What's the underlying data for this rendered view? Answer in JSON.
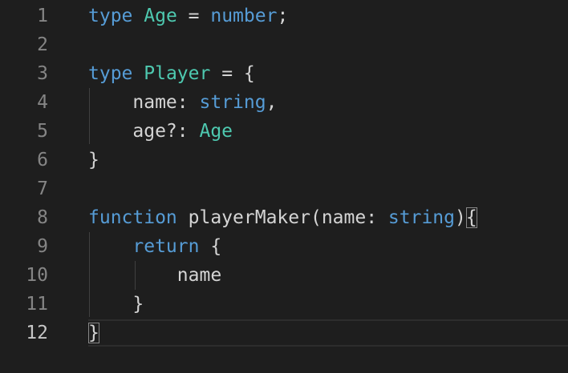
{
  "editor": {
    "current_line": 12,
    "lines": [
      {
        "number": "1",
        "tokens": [
          {
            "t": "type",
            "c": "kw"
          },
          {
            "t": " ",
            "c": "pn"
          },
          {
            "t": "Age",
            "c": "ty"
          },
          {
            "t": " = ",
            "c": "pn"
          },
          {
            "t": "number",
            "c": "kw"
          },
          {
            "t": ";",
            "c": "pn"
          }
        ]
      },
      {
        "number": "2",
        "tokens": []
      },
      {
        "number": "3",
        "tokens": [
          {
            "t": "type",
            "c": "kw"
          },
          {
            "t": " ",
            "c": "pn"
          },
          {
            "t": "Player",
            "c": "ty"
          },
          {
            "t": " = {",
            "c": "pn"
          }
        ]
      },
      {
        "number": "4",
        "tokens": [
          {
            "t": "    name",
            "c": "id"
          },
          {
            "t": ": ",
            "c": "pn"
          },
          {
            "t": "string",
            "c": "kw"
          },
          {
            "t": ",",
            "c": "pn"
          }
        ]
      },
      {
        "number": "5",
        "tokens": [
          {
            "t": "    age?",
            "c": "id"
          },
          {
            "t": ": ",
            "c": "pn"
          },
          {
            "t": "Age",
            "c": "ty"
          }
        ]
      },
      {
        "number": "6",
        "tokens": [
          {
            "t": "}",
            "c": "pn"
          }
        ]
      },
      {
        "number": "7",
        "tokens": []
      },
      {
        "number": "8",
        "tokens": [
          {
            "t": "function",
            "c": "kw"
          },
          {
            "t": " ",
            "c": "pn"
          },
          {
            "t": "playerMaker",
            "c": "id"
          },
          {
            "t": "(",
            "c": "pn"
          },
          {
            "t": "name",
            "c": "id"
          },
          {
            "t": ": ",
            "c": "pn"
          },
          {
            "t": "string",
            "c": "kw"
          },
          {
            "t": ")",
            "c": "pn"
          },
          {
            "t": "{",
            "c": "pn",
            "match": true
          }
        ]
      },
      {
        "number": "9",
        "tokens": [
          {
            "t": "    ",
            "c": "pn"
          },
          {
            "t": "return",
            "c": "kw"
          },
          {
            "t": " {",
            "c": "pn"
          }
        ]
      },
      {
        "number": "10",
        "tokens": [
          {
            "t": "        name",
            "c": "id"
          }
        ]
      },
      {
        "number": "11",
        "tokens": [
          {
            "t": "    }",
            "c": "pn"
          }
        ]
      },
      {
        "number": "12",
        "tokens": [
          {
            "t": "}",
            "c": "pn",
            "match": true
          }
        ]
      }
    ]
  }
}
